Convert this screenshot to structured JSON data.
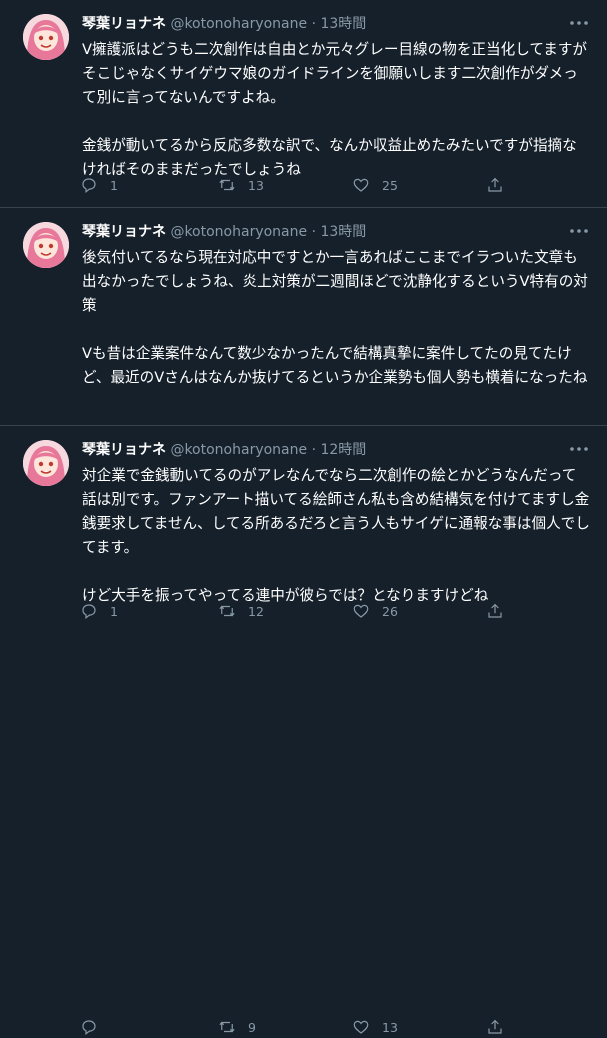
{
  "tweets": [
    {
      "display_name": "琴葉リョナネ",
      "handle": "@kotonoharyonane",
      "separator": "·",
      "time": "13時間",
      "text": "V擁護派はどうも二次創作は自由とか元々グレー目線の物を正当化してますがそこじゃなくサイゲウマ娘のガイドラインを御願いします二次創作がダメって別に言ってないんですよね。\n\n金銭が動いてるから反応多数な訳で、なんか収益止めたみたいですが指摘なければそのままだったでしょうね",
      "replies": "1",
      "retweets": "13",
      "likes": "25"
    },
    {
      "display_name": "琴葉リョナネ",
      "handle": "@kotonoharyonane",
      "separator": "·",
      "time": "13時間",
      "text": "後気付いてるなら現在対応中ですとか一言あればここまでイラついた文章も出なかったでしょうね、炎上対策が二週間ほどで沈静化するというV特有の対策\n\nVも昔は企業案件なんて数少なかったんで結構真摯に案件してたの見てたけど、最近のVさんはなんか抜けてるというか企業勢も個人勢も横着になったね",
      "replies": "1",
      "retweets": "12",
      "likes": "26"
    },
    {
      "display_name": "琴葉リョナネ",
      "handle": "@kotonoharyonane",
      "separator": "·",
      "time": "12時間",
      "text": "対企業で金銭動いてるのがアレなんでなら二次創作の絵とかどうなんだって話は別です。ファンアート描いてる絵師さん私も含め結構気を付けてますし金銭要求してません、してる所あるだろと言う人もサイゲに通報な事は個人でしてます。\n\nけど大手を振ってやってる連中が彼らでは？となりますけどね",
      "replies": "",
      "retweets": "9",
      "likes": "13"
    }
  ],
  "icons": {
    "avatar": "avatar-image",
    "more": "more-options-icon",
    "reply": "reply-icon",
    "retweet": "retweet-icon",
    "like": "like-icon",
    "share": "share-icon"
  },
  "colors": {
    "background": "#15202b",
    "secondary_text": "#8899a6",
    "divider": "#38444d"
  }
}
